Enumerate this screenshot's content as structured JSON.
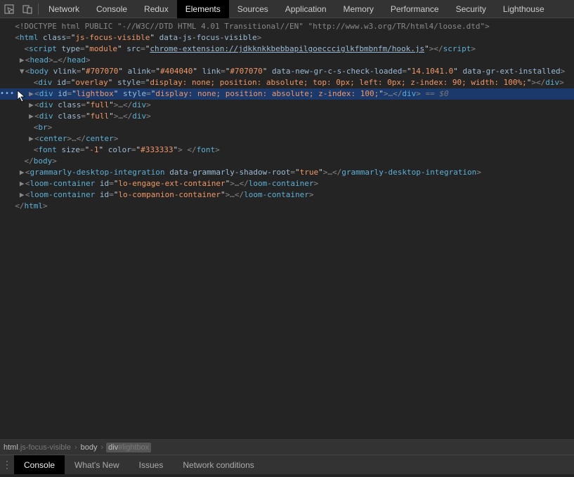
{
  "topTabs": {
    "items": [
      "Network",
      "Console",
      "Redux",
      "Elements",
      "Sources",
      "Application",
      "Memory",
      "Performance",
      "Security",
      "Lighthouse"
    ],
    "activeIndex": 3
  },
  "dom": {
    "doctype": "<!DOCTYPE html PUBLIC \"-//W3C//DTD HTML 4.01 Transitional//EN\" \"http://www.w3.org/TR/html4/loose.dtd\">",
    "htmlOpen": {
      "tag": "html",
      "attrs": [
        {
          "n": "class",
          "v": "js-focus-visible"
        },
        {
          "n": "data-js-focus-visible",
          "v": null
        }
      ]
    },
    "script": {
      "tag": "script",
      "attrs": [
        {
          "n": "type",
          "v": "module"
        },
        {
          "n": "src",
          "v": "chrome-extension://jdkknkkbebbapilgoeccciglkfbmbnfm/hook.js"
        }
      ]
    },
    "headOpen": "head",
    "headClose": "head",
    "bodyOpen": {
      "tag": "body",
      "attrs": [
        {
          "n": "vlink",
          "v": "#707070"
        },
        {
          "n": "alink",
          "v": "#404040"
        },
        {
          "n": "link",
          "v": "#707070"
        },
        {
          "n": "data-new-gr-c-s-check-loaded",
          "v": "14.1041.0"
        },
        {
          "n": "data-gr-ext-installed",
          "v": null
        }
      ]
    },
    "overlay": {
      "tag": "div",
      "attrs": [
        {
          "n": "id",
          "v": "overlay"
        },
        {
          "n": "style",
          "v": "display: none; position: absolute; top: 0px; left: 0px; z-index: 90; width: 100%;"
        }
      ]
    },
    "lightbox": {
      "tag": "div",
      "attrs": [
        {
          "n": "id",
          "v": "lightbox"
        },
        {
          "n": "style",
          "v": "display: none; position: absolute; z-index: 100;"
        }
      ],
      "note": "== $0"
    },
    "full1": {
      "tag": "div",
      "attrs": [
        {
          "n": "class",
          "v": "full"
        }
      ]
    },
    "full2": {
      "tag": "div",
      "attrs": [
        {
          "n": "class",
          "v": "full"
        }
      ]
    },
    "br": "br",
    "center": "center",
    "font": {
      "tag": "font",
      "attrs": [
        {
          "n": "size",
          "v": "-1"
        },
        {
          "n": "color",
          "v": "#333333"
        }
      ],
      "text": " "
    },
    "bodyClose": "body",
    "grammarly": {
      "tag": "grammarly-desktop-integration",
      "attrs": [
        {
          "n": "data-grammarly-shadow-root",
          "v": "true"
        }
      ]
    },
    "loom1": {
      "tag": "loom-container",
      "attrs": [
        {
          "n": "id",
          "v": "lo-engage-ext-container"
        }
      ]
    },
    "loom2": {
      "tag": "loom-container",
      "attrs": [
        {
          "n": "id",
          "v": "lo-companion-container"
        }
      ]
    },
    "htmlClose": "html"
  },
  "breadcrumb": {
    "items": [
      {
        "main": "html",
        "suffix": ".js-focus-visible"
      },
      {
        "main": "body",
        "suffix": ""
      },
      {
        "main": "div",
        "suffix": "#lightbox"
      }
    ],
    "activeIndex": 2
  },
  "bottomTabs": {
    "items": [
      "Console",
      "What's New",
      "Issues",
      "Network conditions"
    ],
    "activeIndex": 0
  },
  "ellipsis": "…",
  "gutterDots": "•••"
}
